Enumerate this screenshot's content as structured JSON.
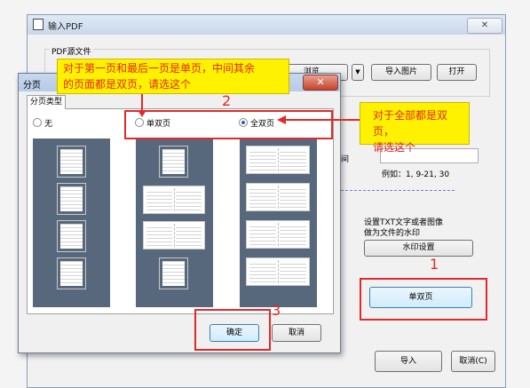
{
  "outer": {
    "title": "输入PDF",
    "close": "✕",
    "source_group": "PDF源文件",
    "browse": "浏览...",
    "dropdown": "▼",
    "import_image": "导入图片",
    "open": "打开",
    "page_label": "间",
    "example": "例如：1, 9-21, 30",
    "watermark_text_line1": "设置TXT文字或者图像",
    "watermark_text_line2": "做为文件的水印",
    "watermark_button": "水印设置",
    "split_button": "单双页",
    "import_button": "导入",
    "cancel_button": "取消(C)"
  },
  "dialog": {
    "title": "分页",
    "close": "✕",
    "tab": "分页类型",
    "options": [
      {
        "label": "无",
        "selected": false
      },
      {
        "label": "单双页",
        "selected": false
      },
      {
        "label": "全双页",
        "selected": true
      }
    ],
    "ok": "确定",
    "cancel": "取消"
  },
  "annotations": {
    "callout_top_line1": "对于第一页和最后一页是单页，中间其余",
    "callout_top_line2": "的页面都是双页，请选这个",
    "callout_right_line1": "对于全部都是双页，",
    "callout_right_line2": "请选这个",
    "num1": "1",
    "num2": "2",
    "num3": "3"
  },
  "colors": {
    "highlight_red": "#e02a2a",
    "callout_yellow": "#fff200",
    "preview_bg": "#57687c"
  }
}
